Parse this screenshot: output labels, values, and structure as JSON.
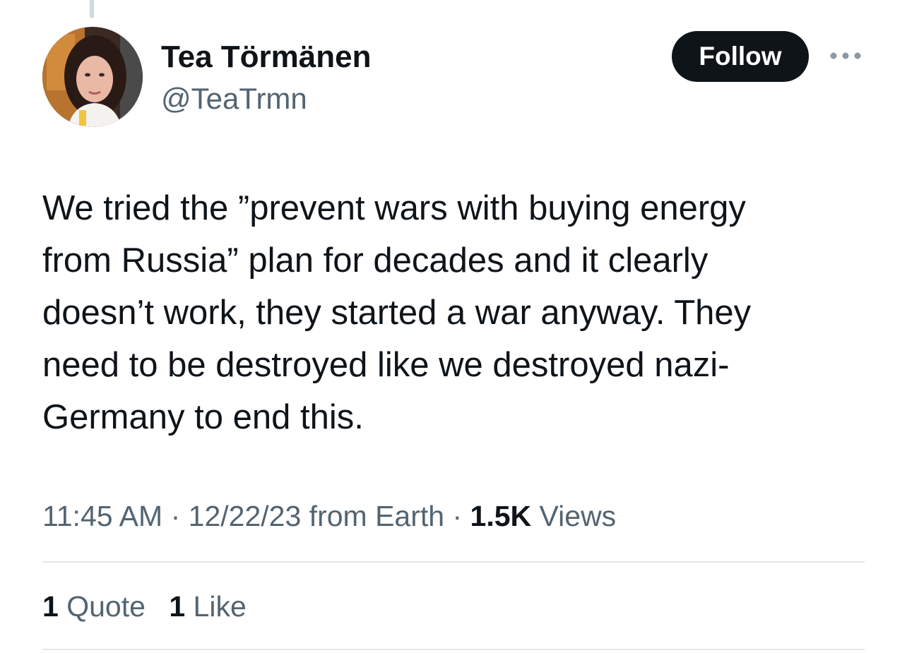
{
  "author": {
    "display_name": "Tea Törmänen",
    "handle": "@TeaTrmn"
  },
  "actions": {
    "follow_label": "Follow",
    "more_icon": "more-horizontal-icon"
  },
  "tweet": {
    "lines": [
      "We tried the ”prevent wars with buying energy",
      "from Russia” plan for decades and it clearly",
      "doesn’t work, they started a war anyway. They",
      "need to be destroyed like we destroyed nazi-",
      "Germany to end this."
    ]
  },
  "meta": {
    "time": "11:45 AM",
    "separator": "·",
    "date": "12/22/23",
    "source": "from Earth",
    "views_count": "1.5K",
    "views_label": "Views"
  },
  "stats": {
    "quotes_count": "1",
    "quotes_label": "Quote",
    "likes_count": "1",
    "likes_label": "Like"
  },
  "colors": {
    "primary_text": "#0f1419",
    "secondary_text": "#536471",
    "divider": "#e1e7ea",
    "follow_bg": "#0f1419"
  }
}
